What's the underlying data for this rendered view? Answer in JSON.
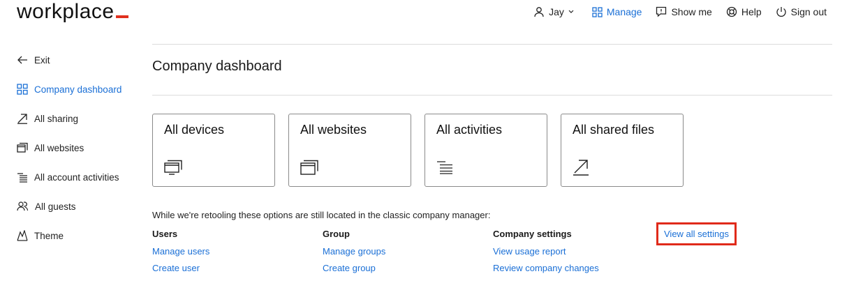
{
  "brand": {
    "logo_text": "workplace",
    "accent": "#e0301e"
  },
  "topnav": {
    "user_label": "Jay",
    "manage_label": "Manage",
    "show_me_label": "Show me",
    "help_label": "Help",
    "sign_out_label": "Sign out",
    "active_color": "#1a6fd6"
  },
  "sidebar": {
    "items": [
      {
        "label": "Exit",
        "icon": "arrow-left-icon"
      },
      {
        "label": "Company dashboard",
        "icon": "grid-icon",
        "active": true
      },
      {
        "label": "All sharing",
        "icon": "share-arrow-icon"
      },
      {
        "label": "All websites",
        "icon": "windows-icon"
      },
      {
        "label": "All account activities",
        "icon": "list-lines-icon"
      },
      {
        "label": "All guests",
        "icon": "guests-icon"
      },
      {
        "label": "Theme",
        "icon": "theme-icon"
      }
    ]
  },
  "main": {
    "title": "Company dashboard",
    "cards": [
      {
        "title": "All devices",
        "icon": "monitor-icon"
      },
      {
        "title": "All websites",
        "icon": "windows-icon"
      },
      {
        "title": "All activities",
        "icon": "list-lines-icon"
      },
      {
        "title": "All shared files",
        "icon": "share-arrow-icon"
      }
    ],
    "note": "While we're retooling these options are still located in the classic company manager:",
    "columns": [
      {
        "heading": "Users",
        "links": [
          "Manage users",
          "Create user"
        ]
      },
      {
        "heading": "Group",
        "links": [
          "Manage groups",
          "Create group"
        ]
      },
      {
        "heading": "Company settings",
        "links": [
          "View usage report",
          "Review company changes"
        ]
      }
    ],
    "view_all_settings": "View all settings",
    "highlight_color": "#e02a1a"
  }
}
